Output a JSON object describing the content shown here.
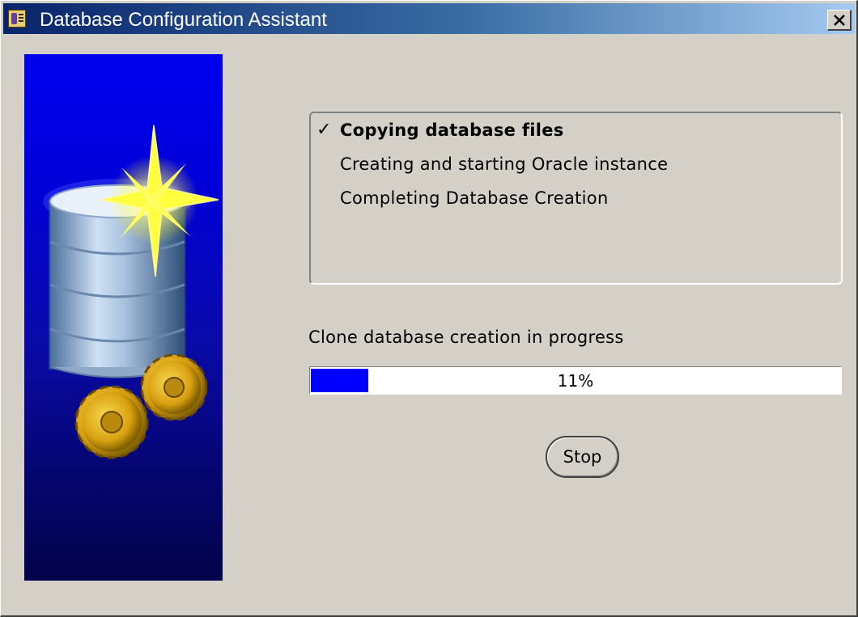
{
  "window": {
    "title": "Database Configuration Assistant",
    "close_label": "×"
  },
  "steps": [
    {
      "label": "Copying database files",
      "state": "current",
      "marker": "✓"
    },
    {
      "label": "Creating and starting Oracle instance",
      "state": "pending"
    },
    {
      "label": "Completing Database Creation",
      "state": "pending"
    }
  ],
  "progress": {
    "label": "Clone database creation in progress",
    "percent": 11,
    "percent_text": "11%",
    "fill_color": "#0000ff"
  },
  "buttons": {
    "stop_label": "Stop"
  },
  "icons": {
    "app": "dbca-app-icon",
    "illustration": "database-cylinder-star-gears"
  }
}
